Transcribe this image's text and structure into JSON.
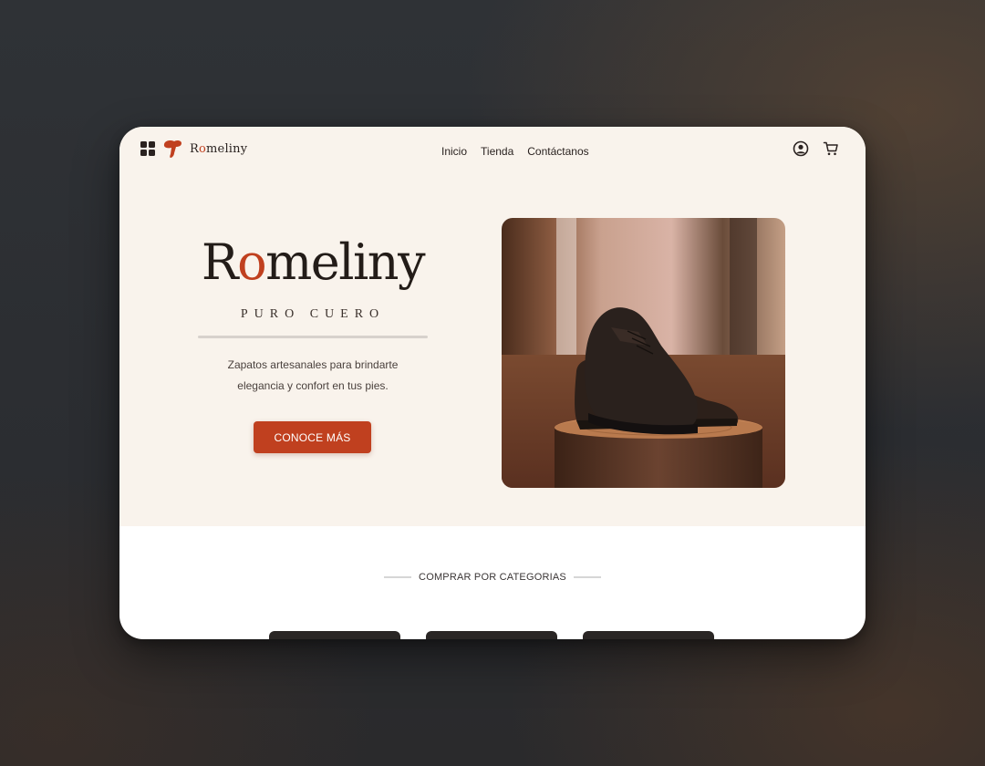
{
  "brand": {
    "logo_prefix": "R",
    "logo_accent": "o",
    "logo_suffix": "meliny"
  },
  "nav": {
    "items": [
      "Inicio",
      "Tienda",
      "Contáctanos"
    ]
  },
  "hero": {
    "title_start": "R",
    "title_accent": "o",
    "title_end": "meliny",
    "tagline": "PURO CUERO",
    "desc_line1": "Zapatos artesanales para brindarte",
    "desc_line2": "elegancia y confort en tus pies.",
    "cta_label": "CONOCE MÁS"
  },
  "categories": {
    "title": "COMPRAR POR CATEGORIAS",
    "card_count": 3
  },
  "colors": {
    "accent": "#c0401f",
    "cream": "#f9f3ec",
    "dark": "#231c18"
  },
  "icons": [
    "grid-icon",
    "logo-mark-icon",
    "user-account-icon",
    "shopping-cart-icon"
  ]
}
